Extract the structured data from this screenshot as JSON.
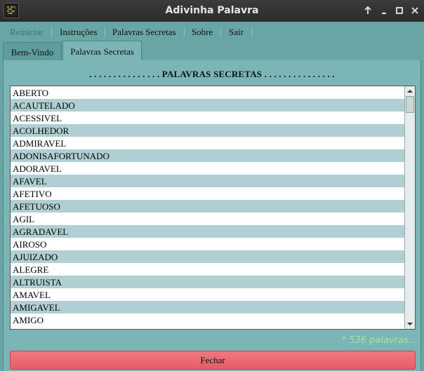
{
  "window": {
    "title": "Adivinha Palavra"
  },
  "menu": {
    "items": [
      {
        "label": "Reiniciar",
        "enabled": false
      },
      {
        "label": "Instruções",
        "enabled": true
      },
      {
        "label": "Palavras Secretas",
        "enabled": true
      },
      {
        "label": "Sobre",
        "enabled": true
      },
      {
        "label": "Sair",
        "enabled": true
      }
    ]
  },
  "tabs": [
    {
      "label": "Bem-Vindo",
      "active": false
    },
    {
      "label": "Palavras Secretas",
      "active": true
    }
  ],
  "panel": {
    "heading": ". . . . . . . . . . . . . . . PALAVRAS SECRETAS . . . . . . . . . . . . . . .",
    "words": [
      "ABERTO",
      "ACAUTELADO",
      "ACESSIVEL",
      "ACOLHEDOR",
      "ADMIRAVEL",
      "ADONISAFORTUNADO",
      "ADORAVEL",
      "AFAVEL",
      "AFETIVO",
      "AFETUOSO",
      "AGIL",
      "AGRADAVEL",
      "AIROSO",
      "AJUIZADO",
      "ALEGRE",
      "ALTRUISTA",
      "AMAVEL",
      "AMIGAVEL",
      "AMIGO"
    ],
    "count_text": "* 536 palavras..",
    "close_label": "Fechar"
  },
  "colors": {
    "background": "#6aa5a5",
    "stripe": "#b0cfd2",
    "close_button": "#ec6a72",
    "count_text": "#9fe89f"
  },
  "icons": [
    "app-icon",
    "maximize-up-icon",
    "minimize-icon",
    "restore-icon",
    "close-icon",
    "scroll-up-icon",
    "scroll-down-icon"
  ]
}
